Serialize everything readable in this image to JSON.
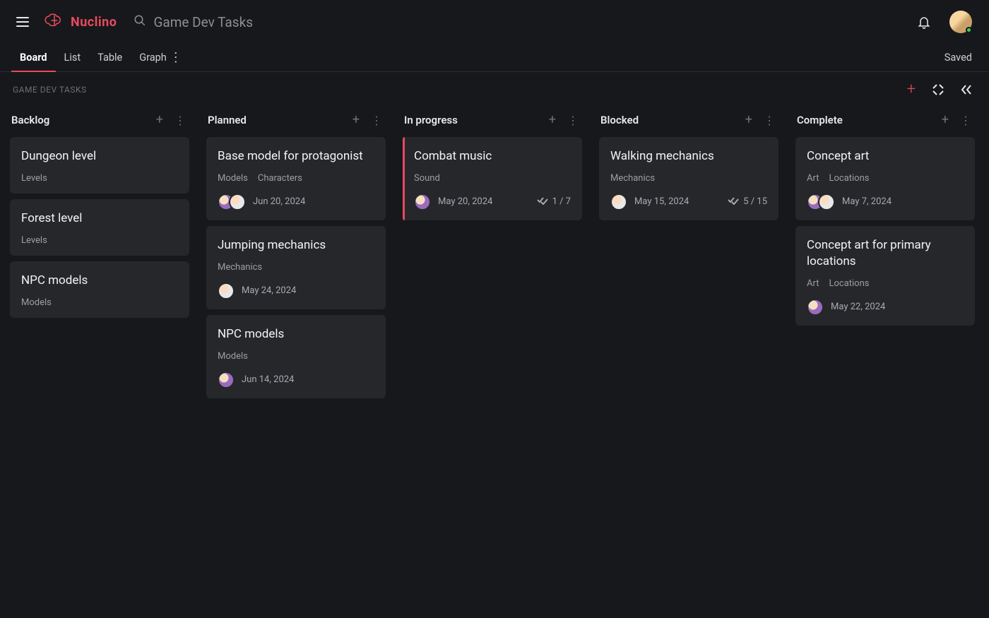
{
  "header": {
    "brand": "Nuclino",
    "search_placeholder": "Game Dev Tasks"
  },
  "viewtabs": {
    "items": [
      "Board",
      "List",
      "Table",
      "Graph"
    ],
    "active_index": 0,
    "saved_label": "Saved"
  },
  "board": {
    "title": "Game Dev Tasks",
    "columns": [
      {
        "title": "Backlog",
        "cards": [
          {
            "title": "Dungeon level",
            "tags": [
              "Levels"
            ],
            "avatars": [],
            "date": "",
            "progress": "",
            "highlight": false
          },
          {
            "title": "Forest level",
            "tags": [
              "Levels"
            ],
            "avatars": [],
            "date": "",
            "progress": "",
            "highlight": false
          },
          {
            "title": "NPC models",
            "tags": [
              "Models"
            ],
            "avatars": [],
            "date": "",
            "progress": "",
            "highlight": false
          }
        ]
      },
      {
        "title": "Planned",
        "cards": [
          {
            "title": "Base model for protagonist",
            "tags": [
              "Models",
              "Characters"
            ],
            "avatars": [
              "a1",
              "a2"
            ],
            "date": "Jun 20, 2024",
            "progress": "",
            "highlight": false
          },
          {
            "title": "Jumping mechanics",
            "tags": [
              "Mechanics"
            ],
            "avatars": [
              "a2"
            ],
            "date": "May 24, 2024",
            "progress": "",
            "highlight": false
          },
          {
            "title": "NPC models",
            "tags": [
              "Models"
            ],
            "avatars": [
              "a1"
            ],
            "date": "Jun 14, 2024",
            "progress": "",
            "highlight": false
          }
        ]
      },
      {
        "title": "In progress",
        "cards": [
          {
            "title": "Combat music",
            "tags": [
              "Sound"
            ],
            "avatars": [
              "a1"
            ],
            "date": "May 20, 2024",
            "progress": "1 / 7",
            "highlight": true
          }
        ]
      },
      {
        "title": "Blocked",
        "cards": [
          {
            "title": "Walking mechanics",
            "tags": [
              "Mechanics"
            ],
            "avatars": [
              "a2"
            ],
            "date": "May 15, 2024",
            "progress": "5 / 15",
            "highlight": false
          }
        ]
      },
      {
        "title": "Complete",
        "cards": [
          {
            "title": "Concept art",
            "tags": [
              "Art",
              "Locations"
            ],
            "avatars": [
              "a1",
              "a2"
            ],
            "date": "May 7, 2024",
            "progress": "",
            "highlight": false
          },
          {
            "title": "Concept art for primary locations",
            "tags": [
              "Art",
              "Locations"
            ],
            "avatars": [
              "a1"
            ],
            "date": "May 22, 2024",
            "progress": "",
            "highlight": false
          }
        ]
      }
    ]
  }
}
